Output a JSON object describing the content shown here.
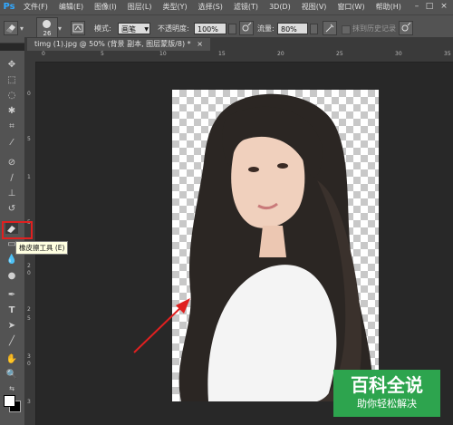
{
  "menubar": {
    "logo": "Ps",
    "items": [
      "文件(F)",
      "编辑(E)",
      "图像(I)",
      "图层(L)",
      "类型(Y)",
      "选择(S)",
      "滤镜(T)",
      "3D(D)",
      "视图(V)",
      "窗口(W)",
      "帮助(H)"
    ],
    "controls": {
      "minimize": "–",
      "maximize": "□",
      "close": "×"
    }
  },
  "options": {
    "brush_size": "26",
    "mode_label": "模式:",
    "mode_value": "画笔",
    "opacity_label": "不透明度:",
    "opacity_value": "100%",
    "flow_label": "流量:",
    "flow_value": "80%",
    "history_label": "抹到历史记录"
  },
  "document": {
    "tab_title": "timg (1).jpg @ 50% (背景 副本, 图层蒙版/8) *",
    "tab_close": "×"
  },
  "rulers": {
    "top": [
      "0",
      "5",
      "10",
      "15",
      "20",
      "25",
      "30",
      "35"
    ],
    "left": [
      "0",
      "5",
      "1",
      "5",
      "2",
      "0",
      "2",
      "5",
      "3",
      "0",
      "3"
    ]
  },
  "tooltip": "橡皮擦工具 (E)",
  "watermark": {
    "title": "百科全说",
    "subtitle": "助你轻松解决"
  },
  "colors": {
    "accent_red": "#e02020",
    "watermark_green": "#2da44e",
    "ps_blue": "#31a8ff"
  }
}
